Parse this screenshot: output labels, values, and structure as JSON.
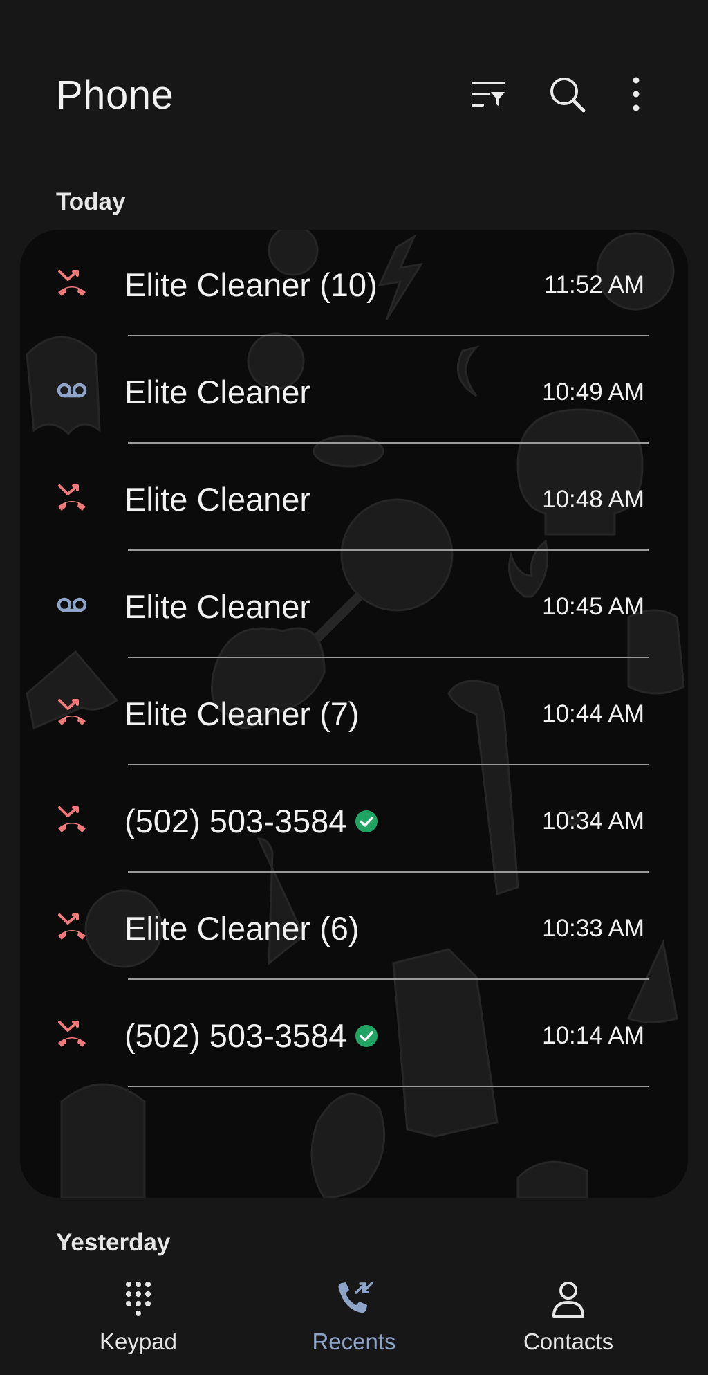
{
  "header": {
    "title": "Phone",
    "icons": [
      "filter-sort-icon",
      "search-icon",
      "more-vertical-icon"
    ]
  },
  "sections": {
    "today": "Today",
    "yesterday": "Yesterday"
  },
  "calls": [
    {
      "name": "Elite Cleaner (10)",
      "time": "11:52 AM",
      "type": "missed",
      "verified": false
    },
    {
      "name": "Elite Cleaner",
      "time": "10:49 AM",
      "type": "voicemail",
      "verified": false
    },
    {
      "name": "Elite Cleaner",
      "time": "10:48 AM",
      "type": "missed",
      "verified": false
    },
    {
      "name": "Elite Cleaner",
      "time": "10:45 AM",
      "type": "voicemail",
      "verified": false
    },
    {
      "name": "Elite Cleaner (7)",
      "time": "10:44 AM",
      "type": "missed",
      "verified": false
    },
    {
      "name": "(502) 503-3584",
      "time": "10:34 AM",
      "type": "missed",
      "verified": true
    },
    {
      "name": "Elite Cleaner (6)",
      "time": "10:33 AM",
      "type": "missed",
      "verified": false
    },
    {
      "name": "(502) 503-3584",
      "time": "10:14 AM",
      "type": "missed",
      "verified": true
    }
  ],
  "nav": {
    "keypad": "Keypad",
    "recents": "Recents",
    "contacts": "Contacts",
    "active": "recents"
  },
  "colors": {
    "missed": "#f0797a",
    "voicemail": "#8fa4c9",
    "verified": "#1fa463",
    "accent": "#8fa4c9"
  }
}
